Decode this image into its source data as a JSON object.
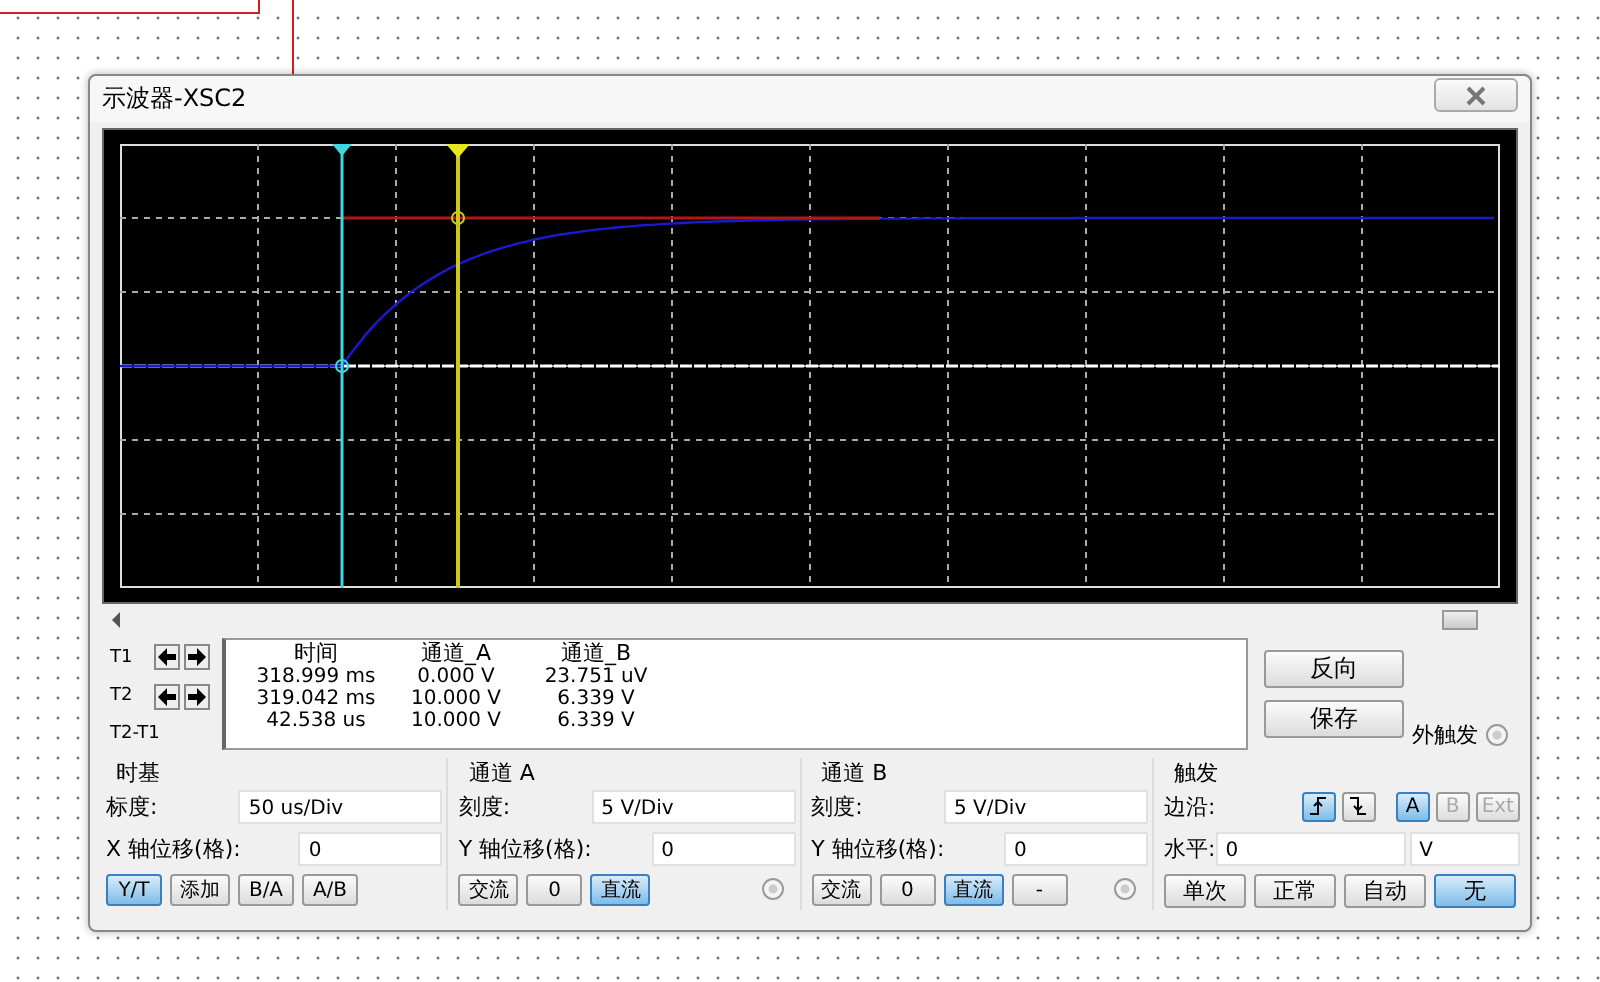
{
  "window": {
    "title": "示波器-XSC2"
  },
  "cursors": {
    "labels": [
      "T1",
      "T2",
      "T2-T1"
    ],
    "columns": [
      "时间",
      "通道_A",
      "通道_B"
    ],
    "rows": [
      {
        "time": "318.999 ms",
        "a": "0.000 V",
        "b": "23.751 uV"
      },
      {
        "time": "319.042 ms",
        "a": "10.000 V",
        "b": "6.339 V"
      },
      {
        "time": "42.538 us",
        "a": "10.000 V",
        "b": "6.339 V"
      }
    ]
  },
  "actions": {
    "reverse": "反向",
    "save": "保存",
    "external_trigger": "外触发",
    "external_trigger_checked": false
  },
  "timebase": {
    "title": "时基",
    "scale_label": "标度:",
    "scale": "50 us/Div",
    "xpos_label": "X 轴位移(格):",
    "xpos": "0",
    "modes": [
      {
        "label": "Y/T",
        "selected": true
      },
      {
        "label": "添加",
        "selected": false
      },
      {
        "label": "B/A",
        "selected": false
      },
      {
        "label": "A/B",
        "selected": false
      }
    ]
  },
  "channel_a": {
    "title": "通道 A",
    "scale_label": "刻度:",
    "scale": "5  V/Div",
    "ypos_label": "Y 轴位移(格):",
    "ypos": "0",
    "radio_checked": false,
    "coupling": [
      {
        "label": "交流",
        "selected": false
      },
      {
        "label": "0",
        "selected": false
      },
      {
        "label": "直流",
        "selected": true
      }
    ]
  },
  "channel_b": {
    "title": "通道 B",
    "scale_label": "刻度:",
    "scale": "5  V/Div",
    "ypos_label": "Y 轴位移(格):",
    "ypos": "0",
    "radio_checked": false,
    "coupling": [
      {
        "label": "交流",
        "selected": false
      },
      {
        "label": "0",
        "selected": false
      },
      {
        "label": "直流",
        "selected": true
      },
      {
        "label": "-",
        "selected": false
      }
    ]
  },
  "trigger": {
    "title": "触发",
    "edge_label": "边沿:",
    "edges": [
      {
        "kind": "rising",
        "selected": true
      },
      {
        "kind": "falling",
        "selected": false
      }
    ],
    "sources": [
      {
        "label": "A",
        "selected": true,
        "disabled": false
      },
      {
        "label": "B",
        "selected": false,
        "disabled": true
      },
      {
        "label": "Ext",
        "selected": false,
        "disabled": true
      }
    ],
    "level_label": "水平:",
    "level_value": "0",
    "level_unit": "V",
    "modes": [
      {
        "label": "单次",
        "selected": false
      },
      {
        "label": "正常",
        "selected": false
      },
      {
        "label": "自动",
        "selected": false
      },
      {
        "label": "无",
        "selected": true
      }
    ]
  }
}
